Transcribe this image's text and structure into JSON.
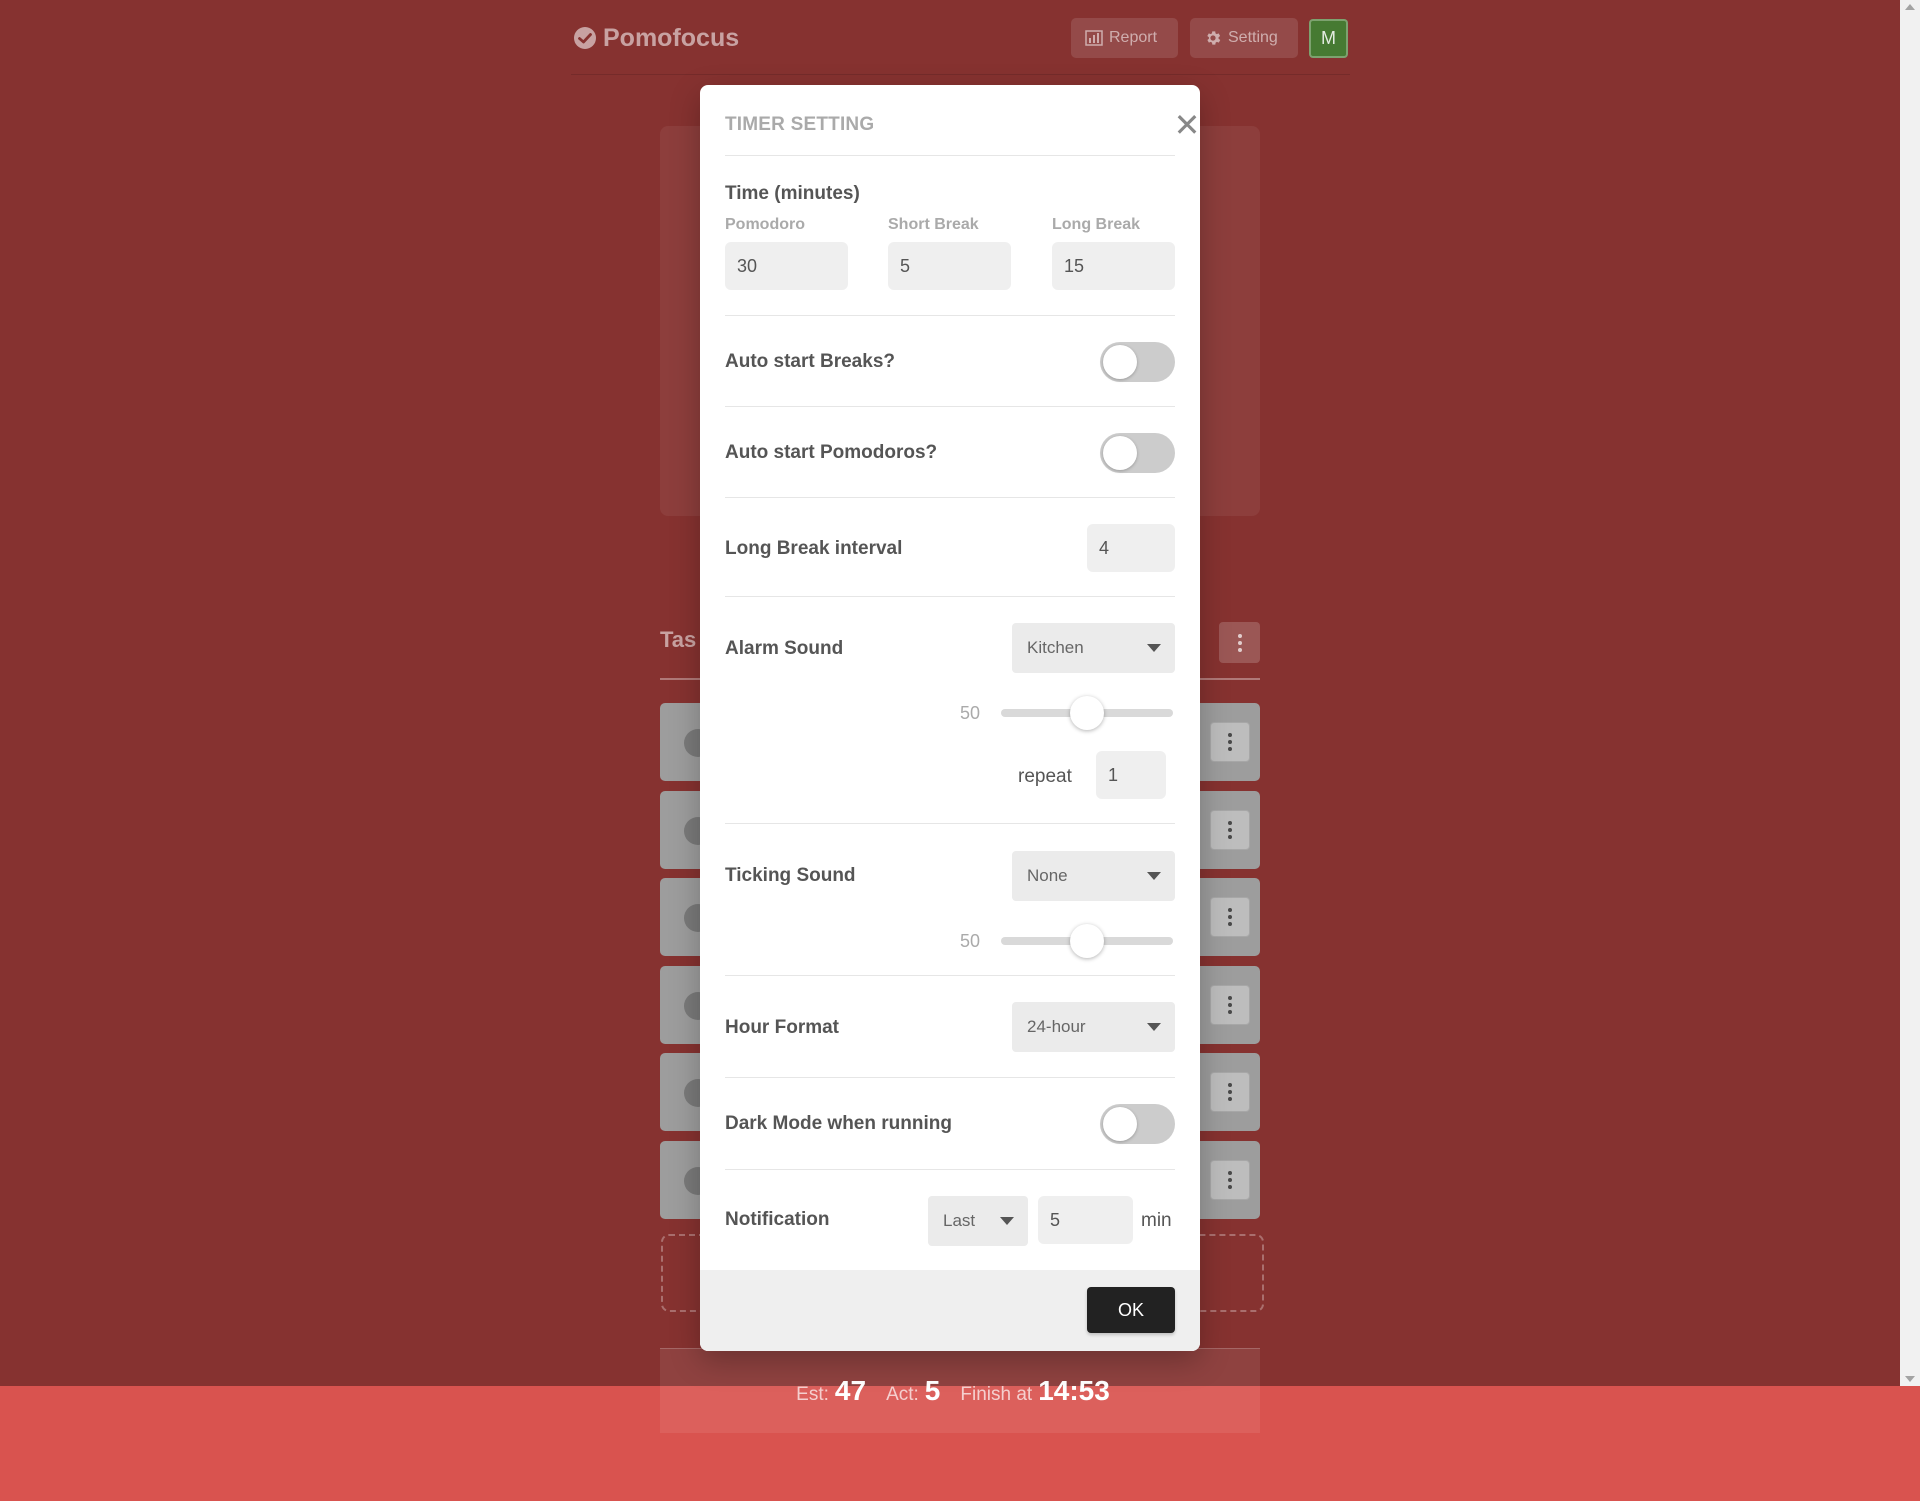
{
  "header": {
    "logo_text": "Pomofocus",
    "report_label": "Report",
    "setting_label": "Setting",
    "avatar_initial": "M"
  },
  "tasks": {
    "title": "Tas"
  },
  "summary": {
    "est_label": "Est:",
    "est_value": "47",
    "act_label": "Act:",
    "act_value": "5",
    "finish_label": "Finish at",
    "finish_value": "14:53"
  },
  "modal": {
    "title": "TIMER SETTING",
    "close_icon": "close-icon",
    "time": {
      "label": "Time (minutes)",
      "pomodoro_label": "Pomodoro",
      "pomodoro_value": "30",
      "short_break_label": "Short Break",
      "short_break_value": "5",
      "long_break_label": "Long Break",
      "long_break_value": "15"
    },
    "auto_start_breaks": {
      "label": "Auto start Breaks?",
      "on": false
    },
    "auto_start_pomodoros": {
      "label": "Auto start Pomodoros?",
      "on": false
    },
    "long_break_interval": {
      "label": "Long Break interval",
      "value": "4"
    },
    "alarm_sound": {
      "label": "Alarm Sound",
      "selected": "Kitchen",
      "volume": "50",
      "volume_fraction": 0.5,
      "repeat_label": "repeat",
      "repeat_value": "1"
    },
    "ticking_sound": {
      "label": "Ticking Sound",
      "selected": "None",
      "volume": "50",
      "volume_fraction": 0.5
    },
    "hour_format": {
      "label": "Hour Format",
      "selected": "24-hour"
    },
    "dark_mode": {
      "label": "Dark Mode when running",
      "on": false
    },
    "notification": {
      "label": "Notification",
      "selected": "Last",
      "value": "5",
      "unit": "min"
    },
    "ok_label": "OK"
  },
  "colors": {
    "background": "#863230",
    "bottom_band": "#d9534f",
    "avatar": "#467a32",
    "ok_button": "#222222"
  }
}
